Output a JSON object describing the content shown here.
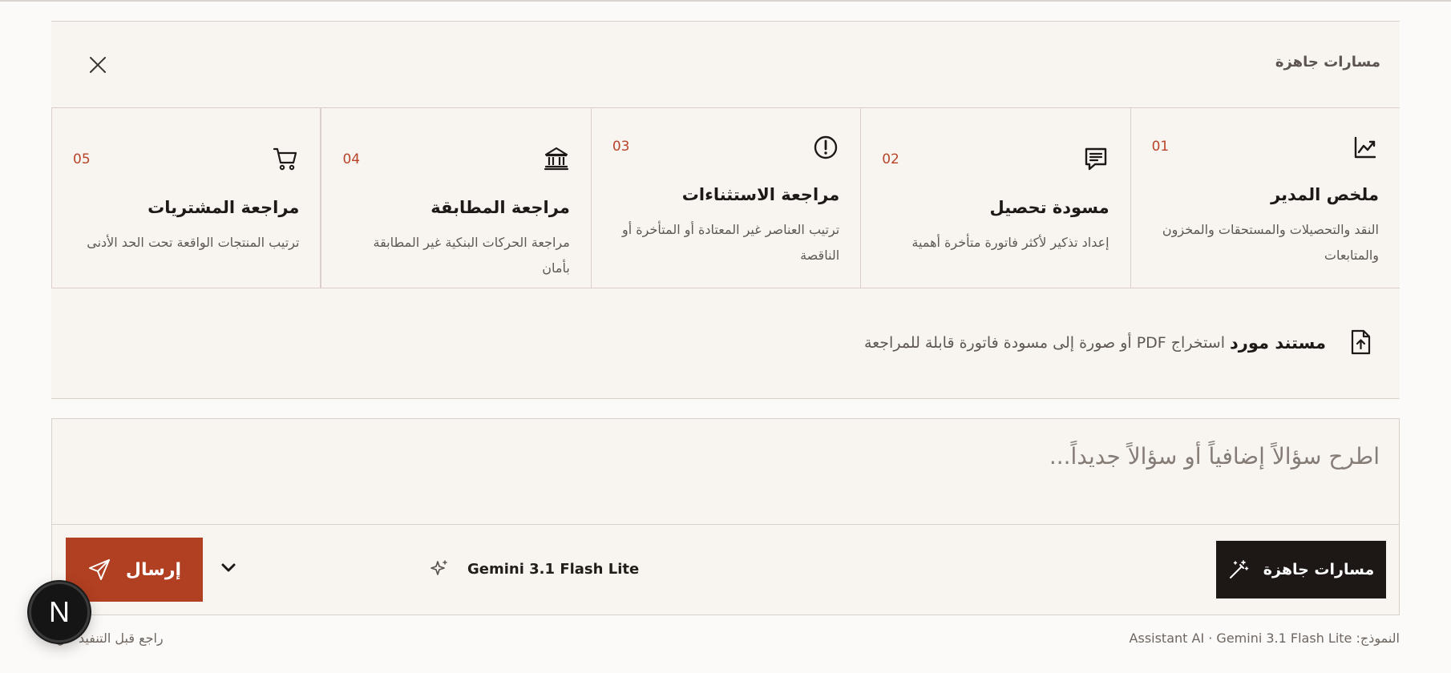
{
  "panel": {
    "title": "مسارات جاهزة",
    "cards": [
      {
        "num": "01",
        "icon": "trend-chart-icon",
        "title": "ملخص المدير",
        "desc": "النقد والتحصيلات والمستحقات والمخزون والمتابعات"
      },
      {
        "num": "02",
        "icon": "document-lines-icon",
        "title": "مسودة تحصيل",
        "desc": "إعداد تذكير لأكثر فاتورة متأخرة أهمية"
      },
      {
        "num": "03",
        "icon": "alert-circle-icon",
        "title": "مراجعة الاستثناءات",
        "desc": "ترتيب العناصر غير المعتادة أو المتأخرة أو الناقصة"
      },
      {
        "num": "04",
        "icon": "bank-icon",
        "title": "مراجعة المطابقة",
        "desc": "مراجعة الحركات البنكية غير المطابقة بأمان"
      },
      {
        "num": "05",
        "icon": "cart-icon",
        "title": "مراجعة المشتريات",
        "desc": "ترتيب المنتجات الواقعة تحت الحد الأدنى"
      }
    ],
    "vendor": {
      "title": "مستند مورد",
      "desc": "استخراج PDF أو صورة إلى مسودة فاتورة قابلة للمراجعة"
    }
  },
  "composer": {
    "placeholder": "اطرح سؤالاً إضافياً أو سؤالاً جديداً...",
    "paths_label": "مسارات جاهزة",
    "model_name": "Gemini 3.1 Flash Lite",
    "send_label": "إرسال"
  },
  "footer": {
    "model_info": "النموذج: Assistant AI · Gemini 3.1 Flash Lite",
    "review_note": "راجع قبل التنفيذ"
  },
  "avatar": {
    "letter": "N"
  },
  "colors": {
    "accent": "#b13f22",
    "dark": "#1d1715",
    "panel_bg": "#f8f5f1",
    "number": "#b8442a"
  }
}
